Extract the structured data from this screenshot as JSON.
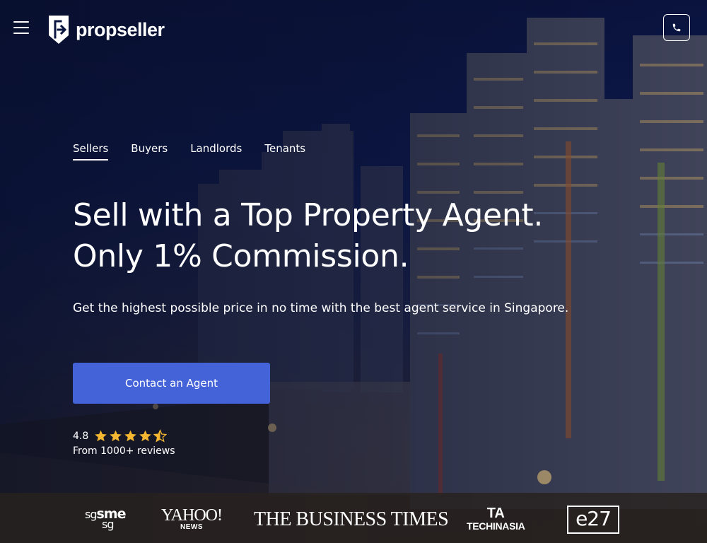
{
  "header": {
    "brand": "propseller",
    "menu_icon": "hamburger-menu-icon",
    "phone_icon": "phone-icon"
  },
  "tabs": [
    {
      "label": "Sellers",
      "active": true
    },
    {
      "label": "Buyers",
      "active": false
    },
    {
      "label": "Landlords",
      "active": false
    },
    {
      "label": "Tenants",
      "active": false
    }
  ],
  "hero": {
    "headline_line1": "Sell with a Top Property Agent.",
    "headline_line2": "Only 1% Commission.",
    "subtext": "Get the highest possible price in no time with the best agent service in Singapore.",
    "cta_label": "Contact an Agent"
  },
  "rating": {
    "value": "4.8",
    "stars": 4.5,
    "reviews_text": "From 1000+ reviews"
  },
  "press": {
    "sgsme_a": "sg",
    "sgsme_b": "sme",
    "sgsme_c": "sg",
    "yahoo": "YAHOO!",
    "yahoo_sub": "NEWS",
    "business_times": "THE BUSINESS TIMES",
    "techinasia_mark": "TA",
    "techinasia": "TECHINASIA",
    "e27": "e27"
  },
  "colors": {
    "cta": "#4563d8",
    "star": "#f5b731",
    "sky": "#0b1640"
  }
}
